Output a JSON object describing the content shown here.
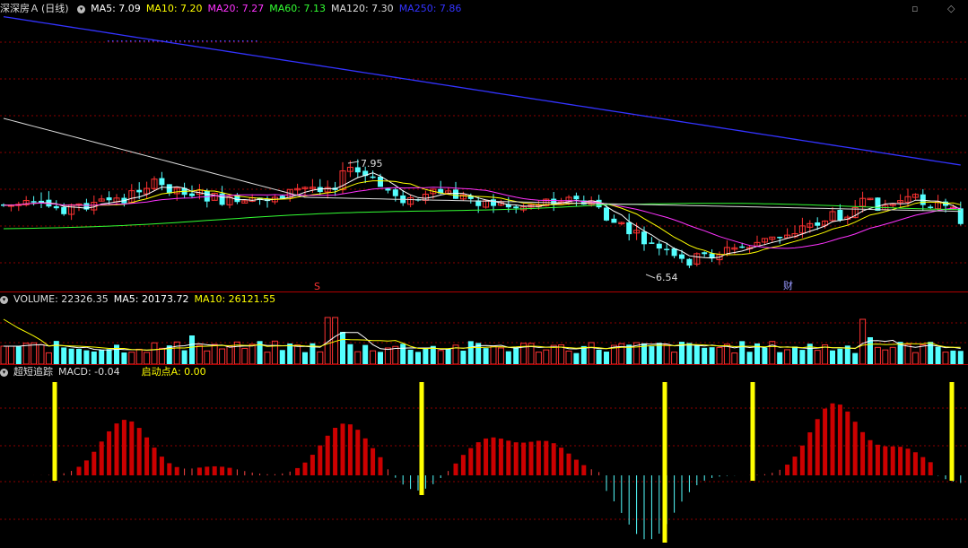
{
  "header": {
    "stock": "深深房Ａ",
    "period": "(日线)",
    "ma": [
      {
        "label": "MA5: 7.09",
        "color": "#ffffff"
      },
      {
        "label": "MA10: 7.20",
        "color": "#ffff00"
      },
      {
        "label": "MA20: 7.27",
        "color": "#ff33ff"
      },
      {
        "label": "MA60: 7.13",
        "color": "#33ff33"
      },
      {
        "label": "MA120: 7.30",
        "color": "#dddddd"
      },
      {
        "label": "MA250: 7.86",
        "color": "#3333ff"
      }
    ]
  },
  "main": {
    "high_label": "7.95",
    "low_label": "6.54",
    "marker_s": "S",
    "marker_cai": "财"
  },
  "volume": {
    "title": "VOLUME: 22326.35",
    "ma5": "MA5: 20173.72",
    "ma10": "MA10: 26121.55"
  },
  "indicator": {
    "name": "超短追踪",
    "macd": "MACD: -0.04",
    "signal": "启动点A: 0.00"
  },
  "controls": {
    "restore": "▫",
    "diamond": "◇"
  },
  "colors": {
    "up": "#ff3232",
    "down": "#54ffff",
    "signal": "#ffff00",
    "grid": "#8b0000"
  }
}
